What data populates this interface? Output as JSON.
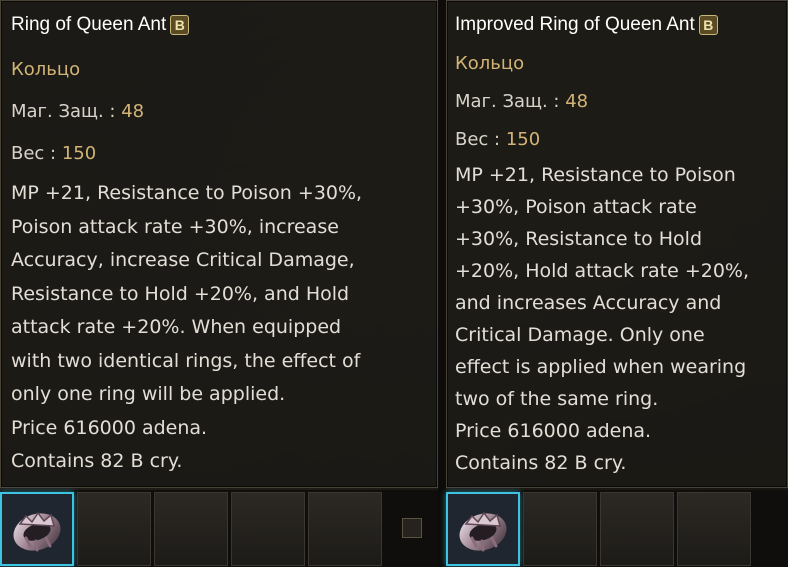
{
  "left_tooltip": {
    "title": "Ring of Queen Ant",
    "grade": "B",
    "type": "Кольцо",
    "stats": [
      {
        "label": "Маг. Защ. : ",
        "value": "48"
      },
      {
        "label": "Вес : ",
        "value": "150"
      }
    ],
    "description_lines": [
      "MP +21, Resistance to Poison +30%,",
      "Poison attack rate +30%, increase",
      "Accuracy, increase Critical Damage,",
      "Resistance to Hold +20%, and Hold",
      "attack rate +20%. When equipped",
      "with two identical rings, the effect of",
      "only one ring will be applied.",
      "Price 616000 adena.",
      "Contains 82 B cry."
    ]
  },
  "right_tooltip": {
    "title": "Improved Ring of Queen Ant",
    "grade": "B",
    "type": "Кольцо",
    "stats": [
      {
        "label": "Маг. Защ. : ",
        "value": "48"
      },
      {
        "label": "Вес : ",
        "value": "150"
      }
    ],
    "description_lines": [
      "MP +21, Resistance to Poison",
      "+30%, Poison attack rate",
      "+30%, Resistance to Hold",
      "+20%, Hold attack rate +20%,",
      "and increases Accuracy and",
      "Critical Damage. Only one",
      "effect is applied when wearing",
      "two of the same ring.",
      "Price 616000 adena.",
      "Contains 82 B cry."
    ]
  },
  "icons": {
    "ring": "ring-of-queen-ant-icon"
  },
  "colors": {
    "title": "#ffffff",
    "accent": "#d3b477",
    "text": "#e2ded6",
    "selection": "#3fc2e0"
  }
}
